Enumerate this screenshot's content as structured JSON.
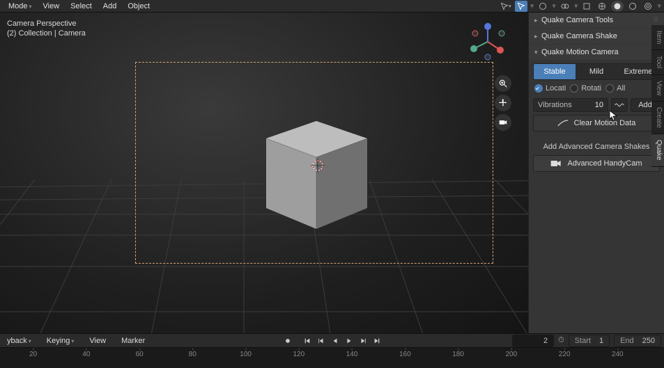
{
  "top_menu": {
    "mode": "Mode",
    "view": "View",
    "select": "Select",
    "add": "Add",
    "object": "Object"
  },
  "overlay": {
    "cam": "Camera Perspective",
    "coll": "(2)  Collection | Camera"
  },
  "sidebar": {
    "panels": {
      "tools": "Quake Camera Tools",
      "shake": "Quake Camera Shake",
      "motion": "Quake Motion Camera"
    },
    "intensity": {
      "stable": "Stable",
      "mild": "Mild",
      "extreme": "Extreme"
    },
    "axis": {
      "loc": "Locati",
      "rot": "Rotati",
      "all": "All"
    },
    "vib": {
      "label": "Vibrations",
      "value": "10"
    },
    "add": "Add",
    "clear": "Clear Motion Data",
    "adv_label": "Add Advanced Camera Shakes",
    "handycam": "Advanced HandyCam"
  },
  "vtabs": {
    "item": "Item",
    "tool": "Tool",
    "view": "View",
    "create": "Create",
    "quake": "Quake"
  },
  "timeline": {
    "playback": "yback",
    "keying": "Keying",
    "view": "View",
    "marker": "Marker",
    "current": "2",
    "start_l": "Start",
    "start_v": "1",
    "end_l": "End",
    "end_v": "250",
    "ticks": [
      "20",
      "40",
      "60",
      "80",
      "100",
      "120",
      "140",
      "160",
      "180",
      "200",
      "220",
      "240"
    ]
  },
  "colors": {
    "accent": "#4a7fb8",
    "frame": "#d4a574"
  }
}
